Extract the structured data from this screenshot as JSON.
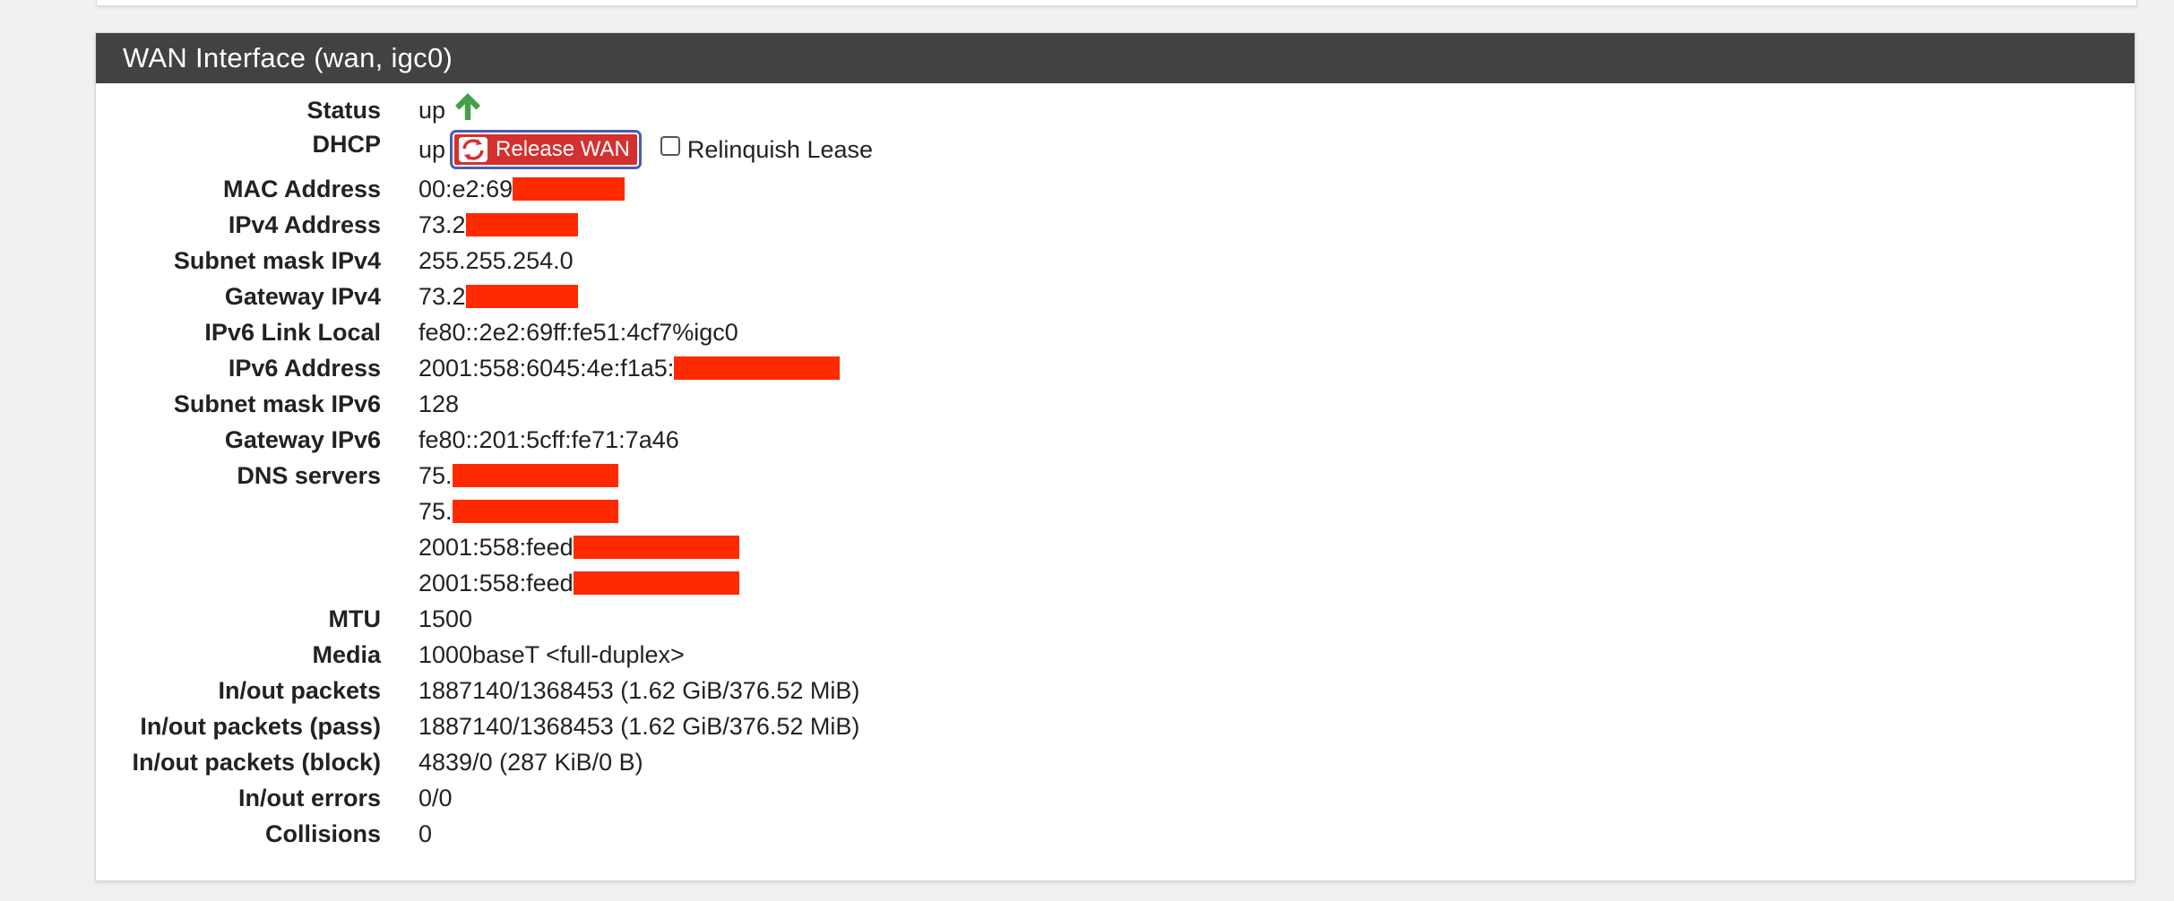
{
  "panel": {
    "title": "WAN Interface (wan, igc0)"
  },
  "rows": {
    "status": {
      "label": "Status",
      "value": "up"
    },
    "dhcp": {
      "label": "DHCP",
      "value": "up",
      "button": "Release WAN",
      "checkbox_label": "Relinquish Lease"
    },
    "mac": {
      "label": "MAC Address",
      "value": "00:e2:69"
    },
    "ipv4": {
      "label": "IPv4 Address",
      "value": "73.2"
    },
    "subnet4": {
      "label": "Subnet mask IPv4",
      "value": "255.255.254.0"
    },
    "gateway4": {
      "label": "Gateway IPv4",
      "value": "73.2"
    },
    "ipv6ll": {
      "label": "IPv6 Link Local",
      "value": "fe80::2e2:69ff:fe51:4cf7%igc0"
    },
    "ipv6": {
      "label": "IPv6 Address",
      "value": "2001:558:6045:4e:f1a5:"
    },
    "subnet6": {
      "label": "Subnet mask IPv6",
      "value": "128"
    },
    "gateway6": {
      "label": "Gateway IPv6",
      "value": "fe80::201:5cff:fe71:7a46"
    },
    "dns": {
      "label": "DNS servers",
      "values": [
        "75.",
        "75.",
        "2001:558:feed",
        "2001:558:feed"
      ]
    },
    "mtu": {
      "label": "MTU",
      "value": "1500"
    },
    "media": {
      "label": "Media",
      "value": "1000baseT <full-duplex>"
    },
    "inout": {
      "label": "In/out packets",
      "value": "1887140/1368453 (1.62 GiB/376.52 MiB)"
    },
    "inout_pass": {
      "label": "In/out packets (pass)",
      "value": "1887140/1368453 (1.62 GiB/376.52 MiB)"
    },
    "inout_block": {
      "label": "In/out packets (block)",
      "value": "4839/0 (287 KiB/0 B)"
    },
    "errors": {
      "label": "In/out errors",
      "value": "0/0"
    },
    "collisions": {
      "label": "Collisions",
      "value": "0"
    }
  },
  "colors": {
    "header_bg": "#424242",
    "redaction": "#ff2a00",
    "button_bg": "#d3312f",
    "status_up": "#43a047"
  }
}
